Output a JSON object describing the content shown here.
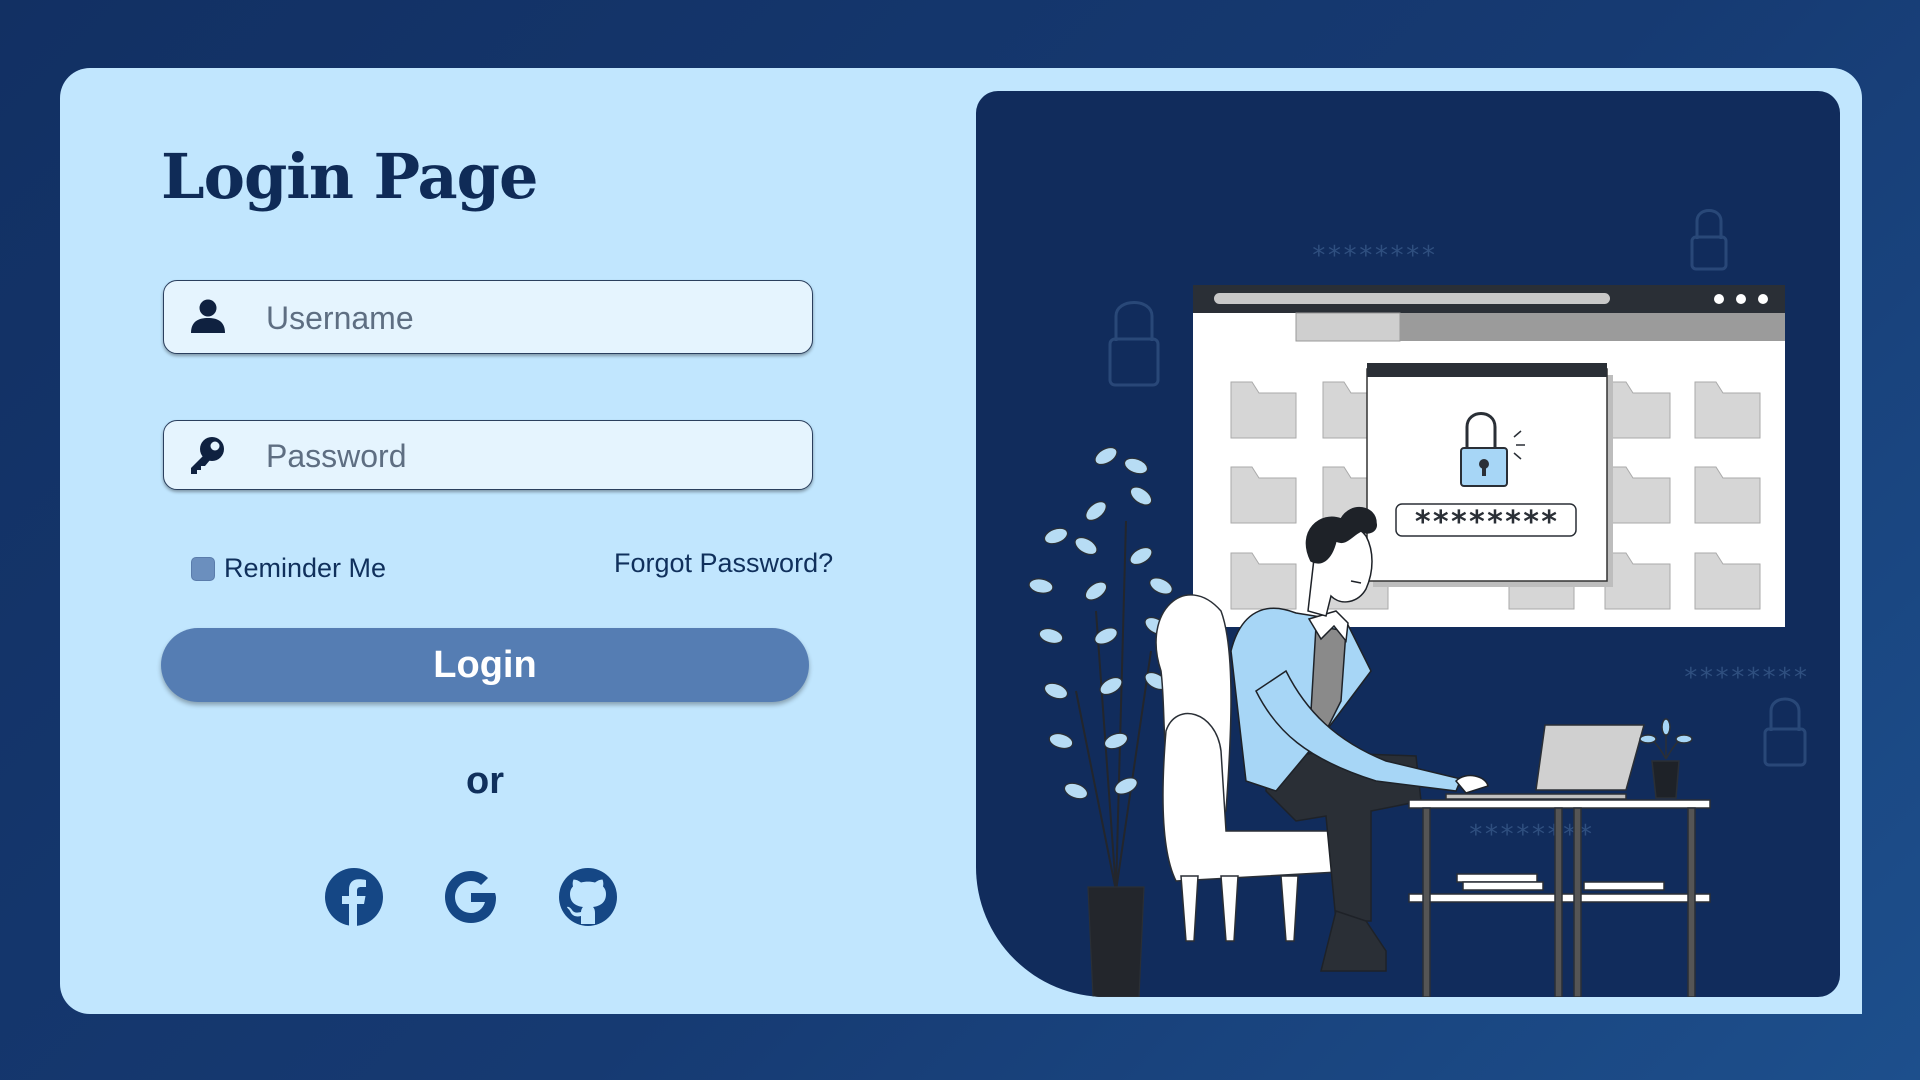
{
  "header": {
    "title": "Login Page"
  },
  "form": {
    "username": {
      "placeholder": "Username",
      "value": ""
    },
    "password": {
      "placeholder": "Password",
      "value": ""
    },
    "remember_label": "Reminder Me",
    "forgot_label": "Forgot Password?",
    "login_label": "Login",
    "or_label": "or"
  },
  "social": [
    {
      "name": "facebook",
      "icon": "facebook-icon"
    },
    {
      "name": "google",
      "icon": "google-icon"
    },
    {
      "name": "github",
      "icon": "github-icon"
    }
  ],
  "illustration": {
    "password_mask": "********",
    "background_mask": "********"
  },
  "colors": {
    "background": "#163a72",
    "card": "#c1e6fe",
    "panel": "#112c5c",
    "accent": "#557db3",
    "text_dark": "#0f2b57"
  }
}
